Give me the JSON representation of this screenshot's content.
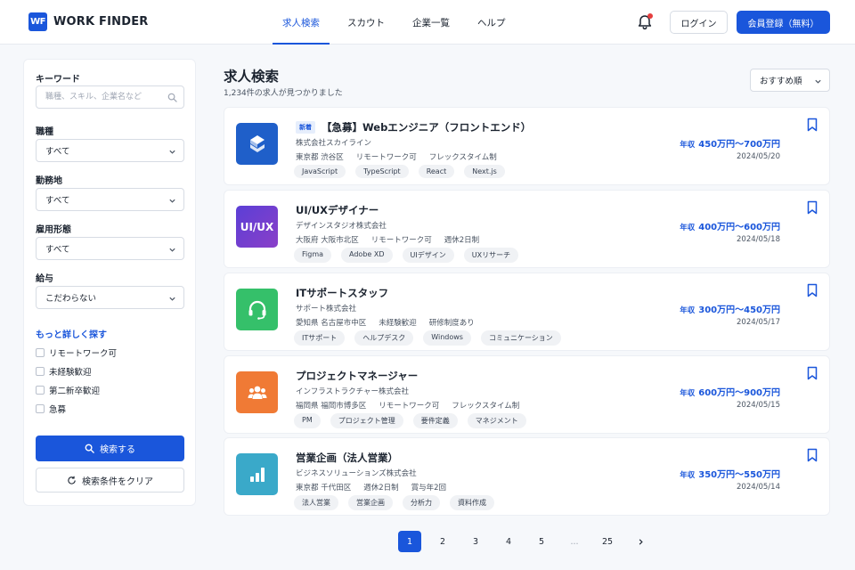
{
  "header": {
    "logo_mark": "WF",
    "logo_text": "WORK FINDER",
    "nav": [
      "求人検索",
      "スカウト",
      "企業一覧",
      "ヘルプ"
    ],
    "login_label": "ログイン",
    "register_label": "会員登録（無料）"
  },
  "sidebar": {
    "keyword_label": "キーワード",
    "keyword_placeholder": "職種、スキル、企業名など",
    "job_type_label": "職種",
    "job_type_value": "すべて",
    "location_label": "勤務地",
    "location_value": "すべて",
    "employment_label": "雇用形態",
    "employment_value": "すべて",
    "salary_label": "給与",
    "salary_value": "こだわらない",
    "more_label": "もっと詳しく探す",
    "checkboxes": [
      "リモートワーク可",
      "未経験歓迎",
      "第二新卒歓迎",
      "急募"
    ],
    "search_label": "検索する",
    "clear_label": "検索条件をクリア"
  },
  "main": {
    "title": "求人検索",
    "count": "1,234件の求人が見つかりました",
    "sort_value": "おすすめ順",
    "salary_prefix": "年収",
    "jobs": [
      {
        "badge": "新着",
        "title": "【急募】Webエンジニア（フロントエンド）",
        "company": "株式会社スカイライン",
        "meta": [
          "東京都 渋谷区",
          "リモートワーク可",
          "フレックスタイム制"
        ],
        "tags": [
          "JavaScript",
          "TypeScript",
          "React",
          "Next.js"
        ],
        "salary": "450万円〜700万円",
        "date": "2024/05/20",
        "logo_icon": "stacked-s-icon",
        "logo_color": "#1f5fc9"
      },
      {
        "title": "UI/UXデザイナー",
        "company": "デザインスタジオ株式会社",
        "meta": [
          "大阪府 大阪市北区",
          "リモートワーク可",
          "週休2日制"
        ],
        "tags": [
          "Figma",
          "Adobe XD",
          "UIデザイン",
          "UXリサーチ"
        ],
        "salary": "400万円〜600万円",
        "date": "2024/05/18",
        "logo_text": "UI/UX",
        "logo_color": "#6b3fd0"
      },
      {
        "title": "ITサポートスタッフ",
        "company": "サポート株式会社",
        "meta": [
          "愛知県 名古屋市中区",
          "未経験歓迎",
          "研修制度あり"
        ],
        "tags": [
          "ITサポート",
          "ヘルプデスク",
          "Windows",
          "コミュニケーション"
        ],
        "salary": "300万円〜450万円",
        "date": "2024/05/17",
        "logo_icon": "headset-icon",
        "logo_color": "#35c06a"
      },
      {
        "title": "プロジェクトマネージャー",
        "company": "インフラストラクチャー株式会社",
        "meta": [
          "福岡県 福岡市博多区",
          "リモートワーク可",
          "フレックスタイム制"
        ],
        "tags": [
          "PM",
          "プロジェクト管理",
          "要件定義",
          "マネジメント"
        ],
        "salary": "600万円〜900万円",
        "date": "2024/05/15",
        "logo_icon": "team-icon",
        "logo_color": "#f07a35"
      },
      {
        "title": "営業企画（法人営業）",
        "company": "ビジネスソリューションズ株式会社",
        "meta": [
          "東京都 千代田区",
          "週休2日制",
          "賞与年2回"
        ],
        "tags": [
          "法人営業",
          "営業企画",
          "分析力",
          "資料作成"
        ],
        "salary": "350万円〜550万円",
        "date": "2024/05/14",
        "logo_icon": "bar-chart-icon",
        "logo_color": "#3aa9c9"
      }
    ]
  },
  "pagination": [
    "1",
    "2",
    "3",
    "4",
    "5",
    "...",
    "25"
  ],
  "pagination_active": "1"
}
